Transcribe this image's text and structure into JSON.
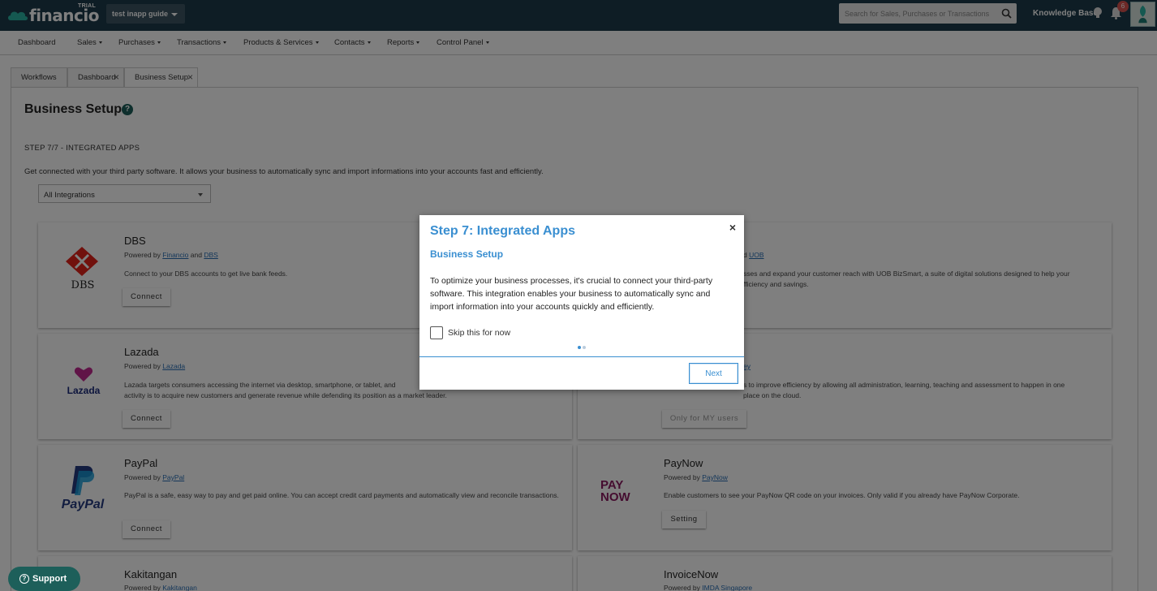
{
  "topbar": {
    "logo_text": "financio",
    "trial_badge": "TRIAL",
    "company": "test inapp guide",
    "search_placeholder": "Search for Sales, Purchases or Transactions",
    "knowledge_base": "Knowledge Base",
    "notification_count": "6",
    "brand_color": "#1d3b4a"
  },
  "nav": {
    "items": [
      "Dashboard",
      "Sales",
      "Purchases",
      "Transactions",
      "Products & Services",
      "Contacts",
      "Reports",
      "Control Panel"
    ]
  },
  "tabs": [
    "Workflows",
    "Dashboard",
    "Business Setup"
  ],
  "page": {
    "title": "Business Setup",
    "help": "?",
    "step_label": "STEP 7/7 - INTEGRATED APPS",
    "step_description": "Get connected with your third party software. It allows your business to automatically sync and import informations into your accounts fast and efficiently.",
    "filter_value": "All Integrations"
  },
  "integrations": {
    "dbs": {
      "name": "DBS",
      "powered_prefix": "Powered by",
      "link1": "Financio",
      "and": "and",
      "link2": "DBS",
      "description": "Connect to your DBS accounts to get live bank feeds.",
      "button": "Connect",
      "logo_text": "DBS"
    },
    "uob": {
      "powered_fragment": "d",
      "link": "UOB",
      "description_l1": "sses and expand your customer reach with UOB BizSmart, a suite of digital solutions designed to help your",
      "description_l2": "fficiency and savings."
    },
    "lazada": {
      "name": "Lazada",
      "powered_prefix": "Powered by",
      "link": "Lazada",
      "description_l1": "Lazada targets consumers accessing the internet via desktop, smartphone, or tablet, and",
      "description_l2": "activity is to acquire new customers and generate revenue while defending its position as a market leader.",
      "button": "Connect",
      "logo_text": "Lazada"
    },
    "my_only": {
      "link_fragment": "ey",
      "description_l1": "s to improve efficiency by allowing all administration, learning, teaching and assessment to happen in one",
      "description_l2": "place on the cloud.",
      "button": "Only for MY users"
    },
    "paypal": {
      "name": "PayPal",
      "powered_prefix": "Powered by",
      "link": "PayPal",
      "description": "PayPal is a safe, easy way to pay and get paid online. You can accept credit card payments and automatically view and reconcile transactions.",
      "button": "Connect",
      "logo_text": "PayPal"
    },
    "paynow": {
      "name": "PayNow",
      "powered_prefix": "Powered by",
      "link": "PayNow",
      "description": "Enable customers to see your PayNow QR code on your invoices. Only valid if you already have PayNow Corporate.",
      "button": "Setting",
      "logo_l1": "PAY",
      "logo_l2": "NOW"
    },
    "kakitangan": {
      "name": "Kakitangan",
      "powered_prefix": "Powered by",
      "link": "Kakitangan"
    },
    "invoicenow": {
      "name": "InvoiceNow",
      "powered_prefix": "Powered by",
      "link": "IMDA Singapore"
    }
  },
  "support": "Support",
  "modal": {
    "title": "Step 7: Integrated Apps",
    "subtitle": "Business Setup",
    "body": "To optimize your business processes, it's crucial to connect your third-party software. This integration enables your business to automatically sync and import information into your accounts quickly and efficiently.",
    "skip_label": "Skip this for now",
    "next_label": "Next",
    "close": "×",
    "accent_color": "#3a8fd1",
    "step_index": 1,
    "step_total": 2
  }
}
